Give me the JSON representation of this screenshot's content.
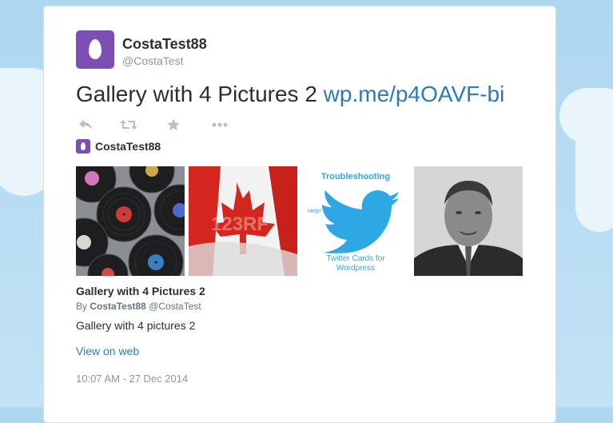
{
  "user": {
    "name": "CostaTest88",
    "handle": "@CostaTest"
  },
  "tweet": {
    "text": "Gallery with 4 Pictures 2",
    "link_text": "wp.me/p4OAVF-bi"
  },
  "actions": [
    {
      "icon": "reply-icon"
    },
    {
      "icon": "retweet-icon"
    },
    {
      "icon": "favorite-icon"
    },
    {
      "icon": "more-icon"
    }
  ],
  "card": {
    "author": "CostaTest88",
    "images": [
      {
        "subject": "vinyl records"
      },
      {
        "subject": "canada flag",
        "watermark": "123RF"
      },
      {
        "subject": "troubleshooting twitter cards",
        "heading": "Troubleshooting",
        "bubble": "Help!",
        "caption": "Twitter Cards for Wordpress"
      },
      {
        "subject": "portrait"
      }
    ],
    "title": "Gallery with 4 Pictures 2",
    "byline_prefix": "By",
    "byline_name": "CostaTest88",
    "byline_handle": "@CostaTest",
    "description": "Gallery with 4 pictures 2",
    "view_on_web": "View on web"
  },
  "timestamp": "10:07 AM - 27 Dec 2014",
  "colors": {
    "accent": "#2b7bb9",
    "avatar": "#7d4fb5",
    "sky": "#aed7f0",
    "twitter_bird": "#2ea8e5"
  }
}
